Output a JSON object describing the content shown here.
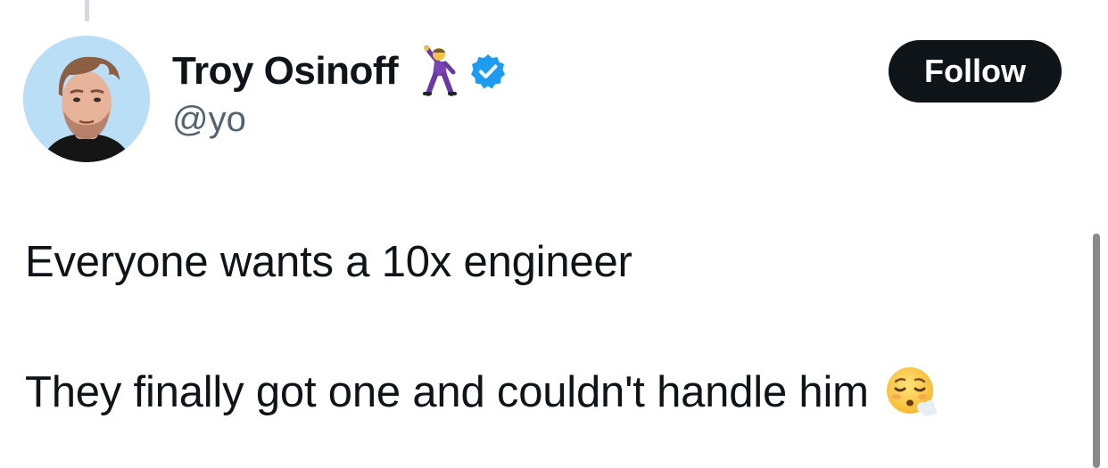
{
  "tweet": {
    "author": {
      "display_name": "Troy Osinoff",
      "handle": "@yo",
      "name_emoji": "man-dancing-emoji",
      "verified_icon": "verified-badge-icon",
      "verified_color": "#1d9bf0"
    },
    "follow_label": "Follow",
    "text_line1": "Everyone wants a 10x engineer",
    "text_line2": "They finally got one and couldn't handle him",
    "text_emoji": "face-exhaling-emoji"
  },
  "colors": {
    "text": "#0f1419",
    "secondary_text": "#536471",
    "button_bg": "#0f1419",
    "button_text": "#ffffff",
    "thread_line": "#cfd9de"
  }
}
